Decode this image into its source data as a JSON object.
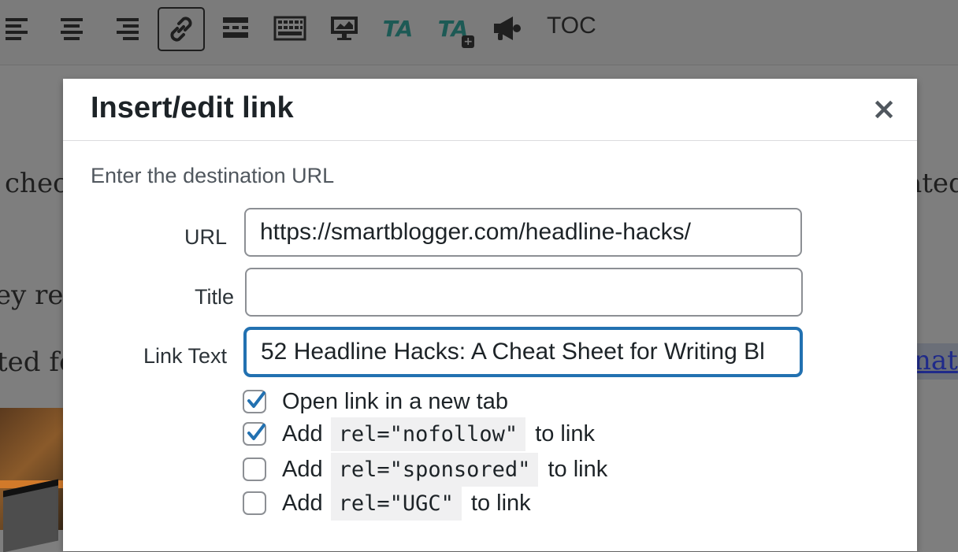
{
  "toolbar": {
    "toc_label": "TOC",
    "buttons": [
      {
        "icon": "align-left-icon"
      },
      {
        "icon": "align-center-icon"
      },
      {
        "icon": "align-right-icon"
      },
      {
        "icon": "insert-link-icon",
        "active": true
      },
      {
        "icon": "read-more-icon"
      },
      {
        "icon": "toolbar-toggle-icon"
      },
      {
        "icon": "monitor-icon"
      },
      {
        "icon": "thirstyaffiliates-icon",
        "text": "TA"
      },
      {
        "icon": "thirstyaffiliates-add-icon",
        "text": "TA"
      },
      {
        "icon": "megaphone-icon"
      }
    ]
  },
  "background": {
    "line1_left": "checl",
    "line1_right": "ated",
    "line2_left": "ey re",
    "line3_left": "ted fo",
    "link_fragment": "nat"
  },
  "modal": {
    "title": "Insert/edit link",
    "close_label": "×",
    "instructions": "Enter the destination URL",
    "url_label": "URL",
    "url_value": "https://smartblogger.com/headline-hacks/",
    "title_label": "Title",
    "title_value": "",
    "link_text_label": "Link Text",
    "link_text_value": "52 Headline Hacks: A Cheat Sheet for Writing Bl",
    "options": [
      {
        "checked": true,
        "prefix": "Open link in a new tab",
        "code": "",
        "suffix": ""
      },
      {
        "checked": true,
        "prefix": "Add",
        "code": "rel=\"nofollow\"",
        "suffix": "to link"
      },
      {
        "checked": false,
        "prefix": "Add",
        "code": "rel=\"sponsored\"",
        "suffix": "to link"
      },
      {
        "checked": false,
        "prefix": "Add",
        "code": "rel=\"UGC\"",
        "suffix": "to link"
      }
    ]
  },
  "colors": {
    "accent": "#2271b1",
    "overlay": "#7e7e7e"
  }
}
